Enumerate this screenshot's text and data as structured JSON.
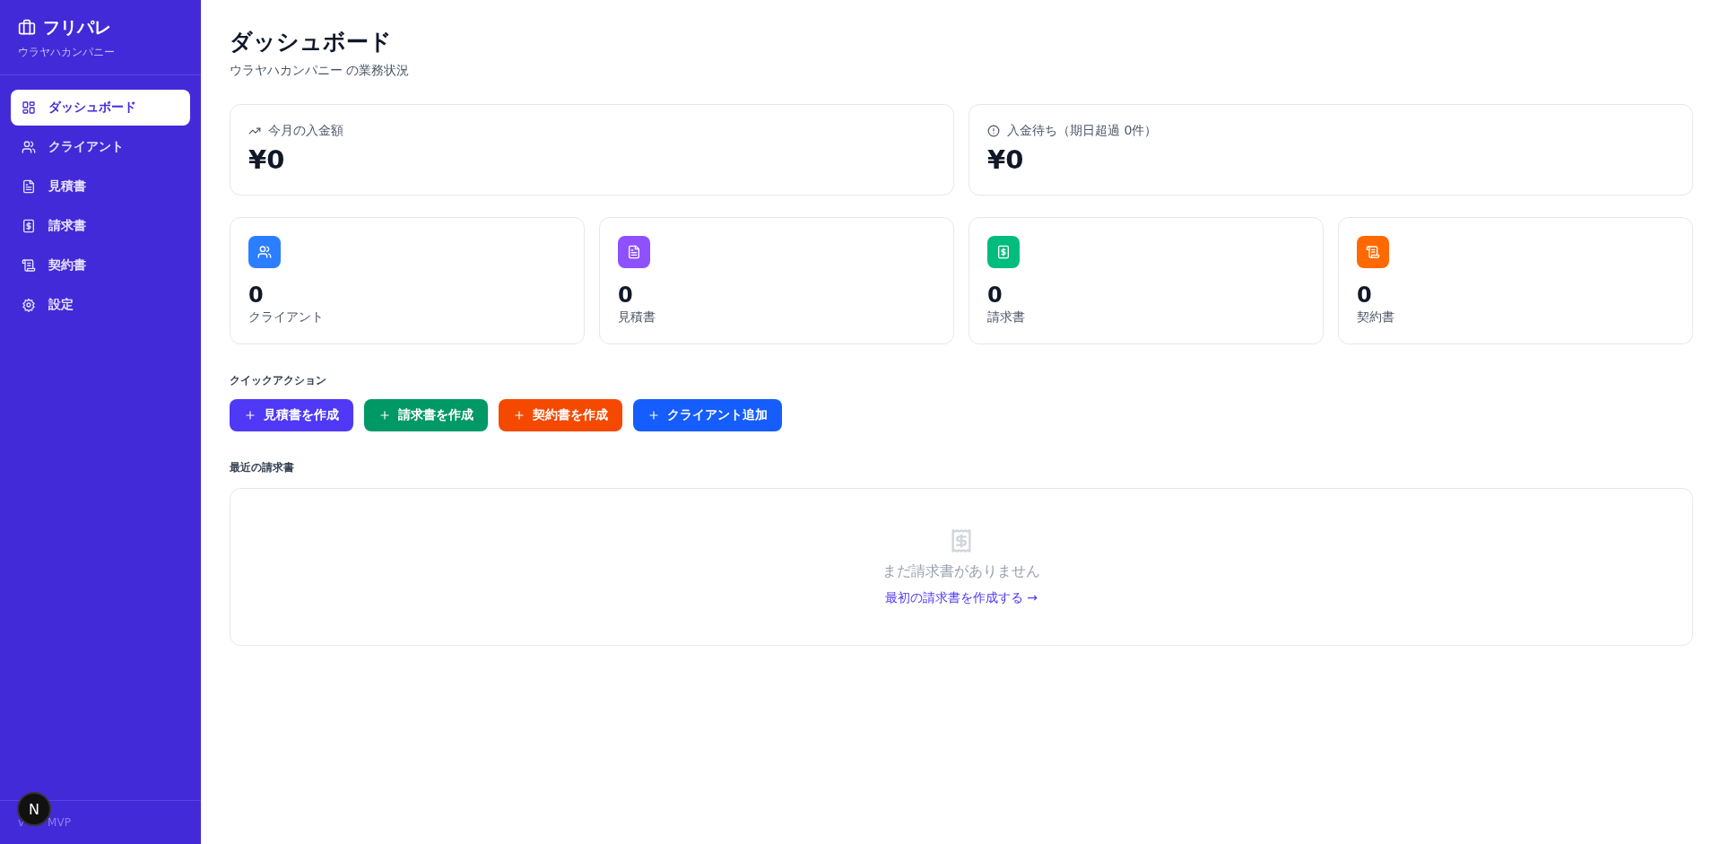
{
  "sidebar": {
    "brand": "フリパレ",
    "company": "ウラヤハカンパニー",
    "items": [
      {
        "label": "ダッシュボード",
        "kind": "grid",
        "selected": true
      },
      {
        "label": "クライアント",
        "kind": "users",
        "selected": false
      },
      {
        "label": "見積書",
        "kind": "file",
        "selected": false
      },
      {
        "label": "請求書",
        "kind": "receipt",
        "selected": false
      },
      {
        "label": "契約書",
        "kind": "scroll",
        "selected": false
      },
      {
        "label": "設定",
        "kind": "gear",
        "selected": false
      }
    ],
    "footer": {
      "version_parts": [
        "v",
        "MVP"
      ],
      "badge": "N"
    }
  },
  "header": {
    "title": "ダッシュボード",
    "subtitle": "ウラヤハカンパニー の業務状況"
  },
  "summary": [
    {
      "label": "今月の入金額",
      "kind": "trend",
      "value": "¥0"
    },
    {
      "label": "入金待ち（期日超過 0件）",
      "kind": "alert",
      "value": "¥0"
    }
  ],
  "stats": [
    {
      "value": "0",
      "label": "クライアント",
      "kind": "users",
      "color": "#2b7fff"
    },
    {
      "value": "0",
      "label": "見積書",
      "kind": "file",
      "color": "#8e51ff"
    },
    {
      "value": "0",
      "label": "請求書",
      "kind": "receipt",
      "color": "#00bc7d"
    },
    {
      "value": "0",
      "label": "契約書",
      "kind": "scroll",
      "color": "#ff6900"
    }
  ],
  "quick_actions": {
    "heading": "クイックアクション",
    "buttons": [
      {
        "label": "見積書を作成",
        "color": "#4f39f6"
      },
      {
        "label": "請求書を作成",
        "color": "#009966"
      },
      {
        "label": "契約書を作成",
        "color": "#f54900"
      },
      {
        "label": "クライアント追加",
        "color": "#155dfc"
      }
    ]
  },
  "recent_invoices": {
    "heading": "最近の請求書",
    "empty_message": "まだ請求書がありません",
    "link": "最初の請求書を作成する →"
  }
}
